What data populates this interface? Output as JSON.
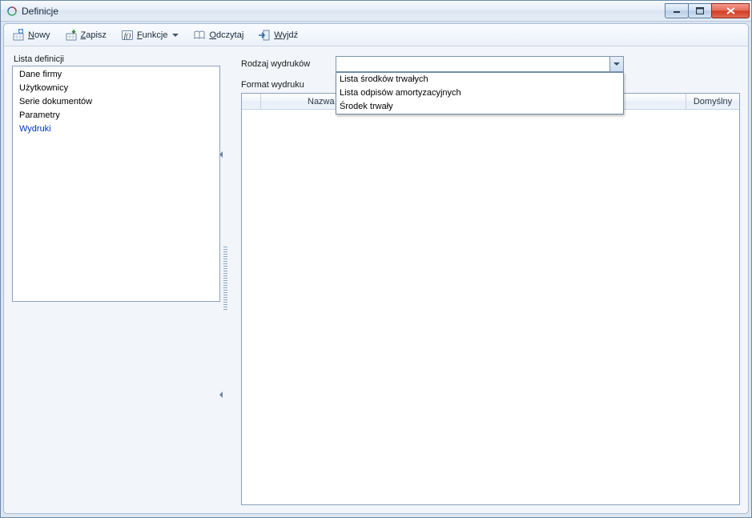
{
  "window": {
    "title": "Definicje"
  },
  "toolbar": {
    "new_label": "Nowy",
    "save_label": "Zapisz",
    "functions_label": "Funkcje",
    "read_label": "Odczytaj",
    "exit_label": "Wyjdź"
  },
  "sidebar": {
    "title": "Lista definicji",
    "items": [
      {
        "label": "Dane firmy",
        "selected": false
      },
      {
        "label": "Użytkownicy",
        "selected": false
      },
      {
        "label": "Serie dokumentów",
        "selected": false
      },
      {
        "label": "Parametry",
        "selected": false
      },
      {
        "label": "Wydruki",
        "selected": true
      }
    ]
  },
  "form": {
    "type_label": "Rodzaj wydruków",
    "format_label": "Format wydruku",
    "type_value": "",
    "type_options": [
      "Lista środków trwałych",
      "Lista odpisów amortyzacyjnych",
      "Środek trwały"
    ]
  },
  "grid": {
    "col_name": "Nazwa f",
    "col_default": "Domyślny"
  }
}
